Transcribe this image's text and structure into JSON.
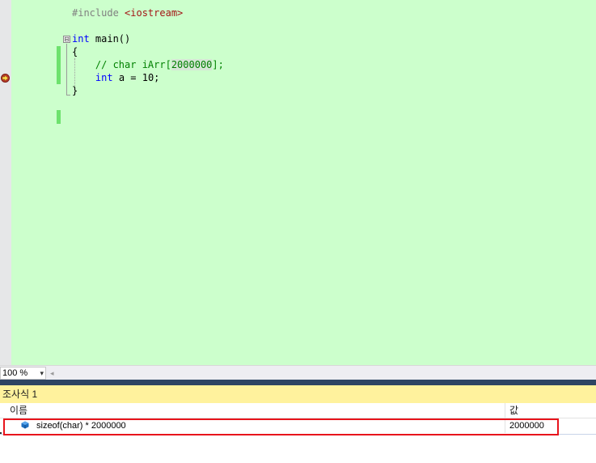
{
  "editor": {
    "lines": [
      {
        "id": "include",
        "parts": [
          {
            "t": "#include ",
            "c": "pp"
          },
          {
            "t": "<iostream>",
            "c": "str"
          }
        ]
      },
      {
        "id": "main-sig",
        "parts": [
          {
            "t": "int",
            "c": "kw"
          },
          {
            "t": " main()",
            "c": ""
          }
        ]
      },
      {
        "id": "open-brace",
        "parts": [
          {
            "t": "{",
            "c": ""
          }
        ]
      },
      {
        "id": "comment",
        "parts": [
          {
            "t": "    // char iArr[",
            "c": "cm"
          },
          {
            "t": "2000000",
            "c": "cm hl"
          },
          {
            "t": "];",
            "c": "cm"
          }
        ]
      },
      {
        "id": "decl",
        "parts": [
          {
            "t": "    ",
            "c": ""
          },
          {
            "t": "int",
            "c": "kw"
          },
          {
            "t": " a = 10;",
            "c": ""
          }
        ]
      },
      {
        "id": "close-brace",
        "parts": [
          {
            "t": "}",
            "c": ""
          }
        ]
      }
    ],
    "fold_symbol": "⊟",
    "breakpoint_icon": "current-statement-arrow-icon"
  },
  "zoom": {
    "value": "100 %",
    "arrow": "▾",
    "scroll_arrow": "◂"
  },
  "watch": {
    "title": "조사식 1",
    "col_name": "이름",
    "col_value": "값",
    "rows": [
      {
        "name": "sizeof(char) * 2000000",
        "value": "2000000",
        "icon": "expression-cube-icon"
      }
    ],
    "highlight_color": "#e8141c"
  }
}
